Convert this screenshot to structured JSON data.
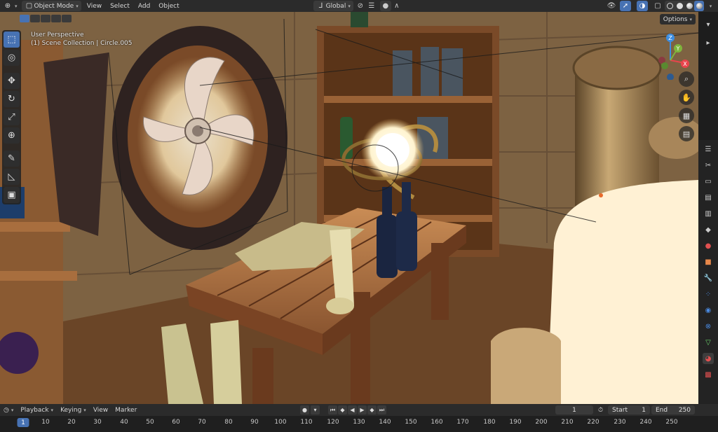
{
  "header": {
    "editor_type_icon": "globe-axes-icon",
    "mode_label": "Object Mode",
    "menus": [
      "View",
      "Select",
      "Add",
      "Object"
    ],
    "transform_orientation": "Global",
    "pivot_icon": "link-icon",
    "snap_icon": "magnet-icon",
    "proportional_icon": "dot-icon"
  },
  "viewport": {
    "perspective_label": "User Perspective",
    "collection_label": "(1) Scene Collection | Circle.005",
    "options_label": "Options",
    "gizmo_axes": [
      "X",
      "Y",
      "Z"
    ]
  },
  "toolbar": {
    "tools": [
      {
        "name": "select-box-tool",
        "glyph": "⬚"
      },
      {
        "name": "cursor-tool",
        "glyph": "◎"
      },
      {
        "name": "move-tool",
        "glyph": "✥"
      },
      {
        "name": "rotate-tool",
        "glyph": "↻"
      },
      {
        "name": "scale-tool",
        "glyph": "⤢"
      },
      {
        "name": "transform-tool",
        "glyph": "⊕"
      },
      {
        "name": "annotate-tool",
        "glyph": "✎"
      },
      {
        "name": "measure-tool",
        "glyph": "📐"
      },
      {
        "name": "add-cube-tool",
        "glyph": "▣"
      }
    ]
  },
  "timeline": {
    "playback_label": "Playback",
    "keying_label": "Keying",
    "view_label": "View",
    "marker_label": "Marker",
    "current_frame": "1",
    "start_label": "Start",
    "start_value": "1",
    "end_label": "End",
    "end_value": "250",
    "ruler_numbers": [
      "1",
      "10",
      "20",
      "30",
      "40",
      "50",
      "60",
      "70",
      "80",
      "90",
      "100",
      "110",
      "120",
      "130",
      "140",
      "150",
      "160",
      "170",
      "180",
      "190",
      "200",
      "210",
      "220",
      "230",
      "240",
      "250"
    ]
  },
  "colors": {
    "accent": "#4772b3",
    "axis_x": "#e8444c",
    "axis_y": "#7fb53c",
    "axis_z": "#3d8de0"
  }
}
